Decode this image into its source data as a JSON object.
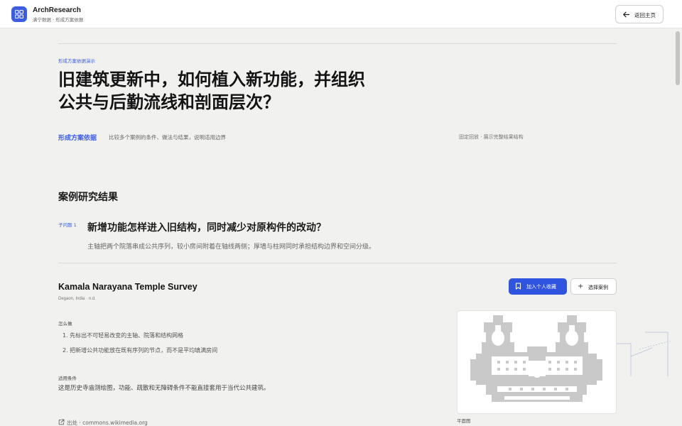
{
  "app": {
    "name": "ArchResearch",
    "subtitle": "满宁数据 · 形成方案依据"
  },
  "header": {
    "back_label": "返回主页"
  },
  "intro": {
    "kicker": "形成方案依据演示",
    "title": "旧建筑更新中，如何植入新功能，并组织公共与后勤流线和剖面层次？",
    "basis_label": "形成方案依据",
    "basis_desc": "比较多个案例的条件、做法与结果，说明适用边界",
    "fixed_note": "固定回放 · 展示完整结果结构"
  },
  "results": {
    "section_title": "案例研究结果",
    "sub_badge": "子问题 1",
    "sub_title": "新增功能怎样进入旧结构，同时减少对原构件的改动？",
    "sub_desc": "主轴把两个院落串成公共序列，较小房间附着在轴线两侧；厚墙与柱网同时承担结构边界和空间分级。"
  },
  "case": {
    "title": "Kamala Narayana Temple Survey",
    "location": "Degaon, India · n.d.",
    "primary_button": "加入个人收藏",
    "secondary_button": "选择案例",
    "how_label": "怎么做",
    "how_items": [
      "1. 先标出不可轻易改变的主轴、院落和结构网格",
      "2. 把新增公共功能放在既有序列的节点，而不是平均填满房间"
    ],
    "conditions_label": "适用条件",
    "conditions_text": "这是历史寺庙测绘图，功能、疏散和无障碍条件不能直接套用于当代公共建筑。",
    "source_label": "出处 · commons.wikimedia.org",
    "plan_caption": "平面图"
  },
  "icons": {
    "logo": "grid-icon",
    "back": "arrow-left-icon",
    "bookmark": "bookmark-icon",
    "plus": "plus-icon",
    "source": "external-link-icon"
  },
  "colors": {
    "accent": "#3b5ce6",
    "primary_button": "#2f54e0",
    "background": "#f1f1ef",
    "plan_fill": "#c9c9c9"
  }
}
